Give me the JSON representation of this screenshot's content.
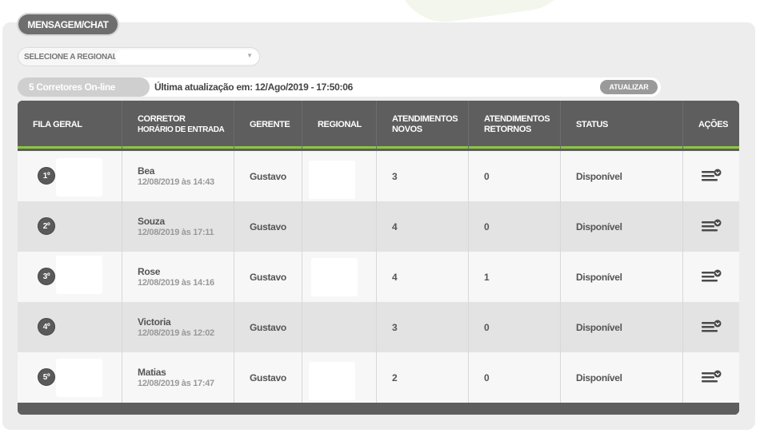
{
  "header": {
    "chat_tab": "MENSAGEM/CHAT",
    "regional_label": "SELECIONE A REGIONAL",
    "regional_value": ""
  },
  "status": {
    "online": "5 Corretores On-line",
    "last_update": "Última atualização em: 12/Ago/2019 - 17:50:06",
    "update_button": "ATUALIZAR"
  },
  "table": {
    "headers": {
      "fila": "FILA GERAL",
      "corretor": "CORRETOR",
      "corretor_sub": "HORÁRIO DE ENTRADA",
      "gerente": "GERENTE",
      "regional": "REGIONAL",
      "novos": "ATENDIMENTOS",
      "novos_sub": "NOVOS",
      "retornos": "ATENDIMENTOS",
      "retornos_sub": "RETORNOS",
      "status": "STATUS",
      "acoes": "AÇÕES"
    },
    "rows": [
      {
        "rank": "1º",
        "name": "Bea",
        "time": "12/08/2019 às 14:43",
        "gerente": "Gustavo",
        "novos": "3",
        "retornos": "0",
        "status": "Disponível"
      },
      {
        "rank": "2º",
        "name": "Souza",
        "time": "12/08/2019 às 17:11",
        "gerente": "Gustavo",
        "novos": "4",
        "retornos": "0",
        "status": "Disponível"
      },
      {
        "rank": "3º",
        "name": "Rose",
        "time": "12/08/2019 às 14:16",
        "gerente": "Gustavo",
        "novos": "4",
        "retornos": "1",
        "status": "Disponível"
      },
      {
        "rank": "4º",
        "name": "Victoria",
        "time": "12/08/2019 às 12:02",
        "gerente": "Gustavo",
        "novos": "3",
        "retornos": "0",
        "status": "Disponível"
      },
      {
        "rank": "5º",
        "name": "Matias",
        "time": "12/08/2019 às 17:47",
        "gerente": "Gustavo",
        "novos": "2",
        "retornos": "0",
        "status": "Disponível"
      }
    ]
  },
  "colors": {
    "header_bg": "#5e5e5e",
    "accent_green": "#8dc63f"
  },
  "icons": {
    "action": "list-menu-with-chevron-icon",
    "dropdown": "chevron-down-icon"
  }
}
